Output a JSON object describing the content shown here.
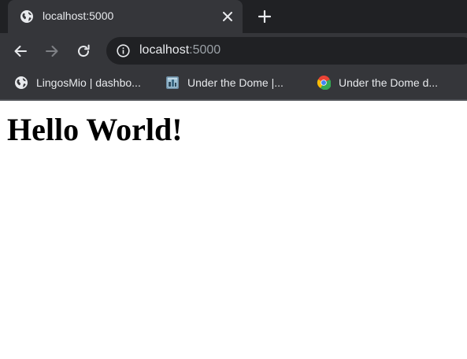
{
  "tab": {
    "title": "localhost:5000",
    "favicon": "globe-icon"
  },
  "toolbar": {
    "back_icon": "back-arrow-icon",
    "forward_icon": "forward-arrow-icon",
    "reload_icon": "reload-icon"
  },
  "omnibox": {
    "info_icon": "info-icon",
    "url_host": "localhost",
    "url_port": ":5000"
  },
  "bookmarks": [
    {
      "label": "LingosMio | dashbo...",
      "icon": "globe-icon"
    },
    {
      "label": "Under the Dome |...",
      "icon": "tv-show-icon"
    },
    {
      "label": "Under the Dome d...",
      "icon": "google-icon"
    }
  ],
  "page": {
    "heading": "Hello World!"
  },
  "colors": {
    "tabstrip_bg": "#202124",
    "toolbar_bg": "#35363a",
    "text": "#e8eaed",
    "muted": "#9aa0a6"
  }
}
